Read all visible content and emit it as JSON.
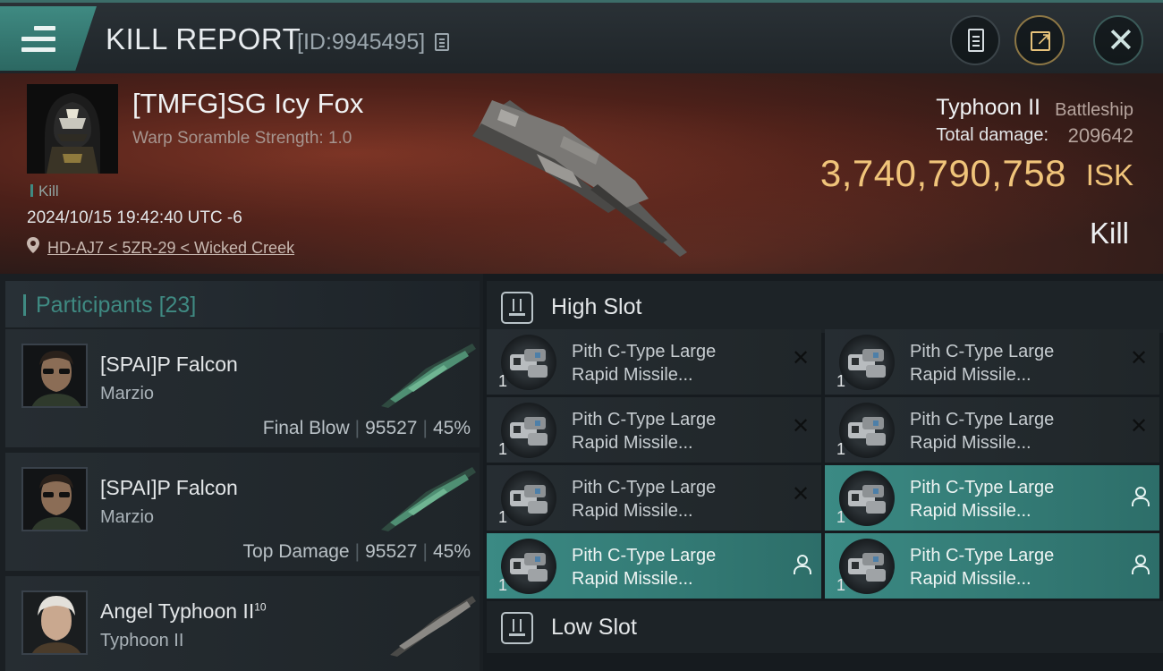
{
  "titlebar": {
    "title": "KILL REPORT",
    "report_id": "[ID:9945495]",
    "icons": [
      "menu-icon",
      "copy-icon",
      "report-icon",
      "share-icon",
      "close-icon"
    ]
  },
  "victim": {
    "name": "[TMFG]SG Icy Fox",
    "warp_scramble": "Warp Soramble Strength: 1.0",
    "kill_tag": "Kill",
    "datetime": "2024/10/15 19:42:40 UTC -6",
    "location": "HD-AJ7 < 5ZR-29 < Wicked Creek"
  },
  "ship": {
    "name": "Typhoon II",
    "class": "Battleship",
    "total_damage_label": "Total damage:",
    "total_damage": "209642",
    "isk_value": "3,740,790,758",
    "isk_unit": "ISK",
    "result": "Kill"
  },
  "participants": {
    "title": "Participants",
    "count": "[23]",
    "items": [
      {
        "name": "[SPAI]P Falcon",
        "ship": "Marzio",
        "role": "Final Blow",
        "damage": "95527",
        "percent": "45%"
      },
      {
        "name": "[SPAI]P Falcon",
        "ship": "Marzio",
        "role": "Top Damage",
        "damage": "95527",
        "percent": "45%"
      },
      {
        "name": "Angel Typhoon II",
        "name_sup": "10",
        "ship": "Typhoon II"
      }
    ]
  },
  "slots": {
    "high_title": "High Slot",
    "low_title": "Low Slot",
    "high_items": [
      {
        "qty": "1",
        "line1": "Pith C-Type Large",
        "line2": "Rapid Missile...",
        "status": "destroyed"
      },
      {
        "qty": "1",
        "line1": "Pith C-Type Large",
        "line2": "Rapid Missile...",
        "status": "destroyed"
      },
      {
        "qty": "1",
        "line1": "Pith C-Type Large",
        "line2": "Rapid Missile...",
        "status": "destroyed"
      },
      {
        "qty": "1",
        "line1": "Pith C-Type Large",
        "line2": "Rapid Missile...",
        "status": "destroyed"
      },
      {
        "qty": "1",
        "line1": "Pith C-Type Large",
        "line2": "Rapid Missile...",
        "status": "destroyed"
      },
      {
        "qty": "1",
        "line1": "Pith C-Type Large",
        "line2": "Rapid Missile...",
        "status": "dropped"
      },
      {
        "qty": "1",
        "line1": "Pith C-Type Large",
        "line2": "Rapid Missile...",
        "status": "dropped"
      },
      {
        "qty": "1",
        "line1": "Pith C-Type Large",
        "line2": "Rapid Missile...",
        "status": "dropped"
      }
    ],
    "destroyed_glyph": "✕",
    "colors": {
      "dropped": "#3b8a84",
      "accent": "#3f8a82",
      "isk": "#f0c47a"
    }
  }
}
